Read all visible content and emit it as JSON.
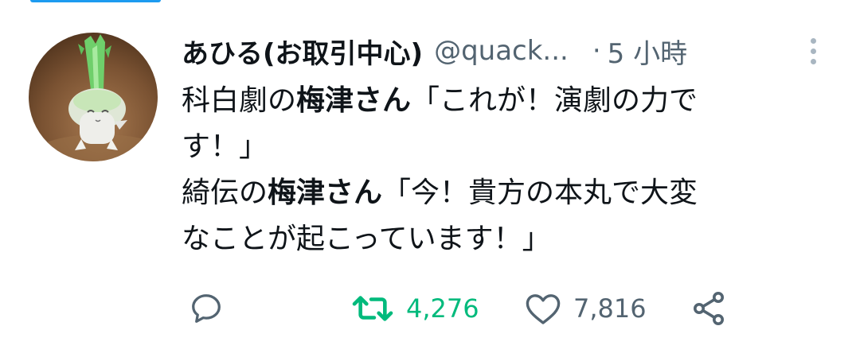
{
  "user": {
    "display_name": "あひる(お取引中心)",
    "handle": "@quack...",
    "separator": "·",
    "time": "5 小時"
  },
  "tweet": {
    "line1_a": "科白劇の",
    "line1_b": "梅津さん",
    "line1_c": "「これが！演劇の力で",
    "line2": "す！」",
    "line3_a": "綺伝の",
    "line3_b": "梅津さん",
    "line3_c": "「今！貴方の本丸で大変",
    "line4": "なことが起こっています！」"
  },
  "actions": {
    "reply_icon": "reply-icon",
    "retweet_icon": "retweet-icon",
    "retweet_count": "4,276",
    "like_icon": "heart-icon",
    "like_count": "7,816",
    "share_icon": "share-icon"
  },
  "colors": {
    "accent": "#1d9bf0",
    "retweet_active": "#00ba7c",
    "secondary_text": "#536471",
    "primary_text": "#0f1419"
  }
}
